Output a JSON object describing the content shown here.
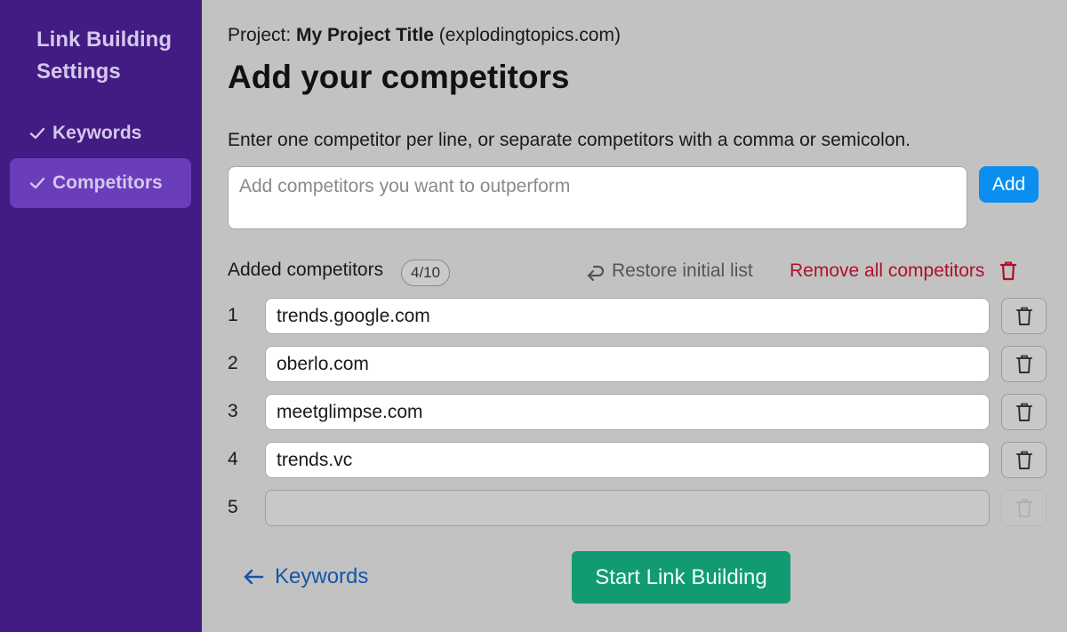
{
  "sidebar": {
    "title": "Link Building Settings",
    "items": [
      {
        "label": "Keywords",
        "completed": true,
        "active": false
      },
      {
        "label": "Competitors",
        "completed": true,
        "active": true
      }
    ]
  },
  "header": {
    "project_prefix": "Project:",
    "project_name": "My Project Title",
    "project_domain": "(explodingtopics.com)",
    "title": "Add your competitors"
  },
  "form": {
    "instructions": "Enter one competitor per line, or separate competitors with a comma or semicolon.",
    "input_placeholder": "Add competitors you want to outperform",
    "add_label": "Add"
  },
  "list": {
    "label": "Added competitors",
    "count": "4/10",
    "restore_label": "Restore initial list",
    "remove_all_label": "Remove all competitors",
    "rows": [
      {
        "num": "1",
        "value": "trends.google.com"
      },
      {
        "num": "2",
        "value": "oberlo.com"
      },
      {
        "num": "3",
        "value": "meetglimpse.com"
      },
      {
        "num": "4",
        "value": "trends.vc"
      },
      {
        "num": "5",
        "value": ""
      }
    ]
  },
  "footer": {
    "back_label": "Keywords",
    "start_label": "Start Link Building"
  },
  "colors": {
    "sidebar_bg": "#421c82",
    "active_item_bg": "#6a3dba",
    "add_button": "#0a8ff0",
    "start_button": "#129b73",
    "remove_red": "#b0102a",
    "link_blue": "#1456a8"
  }
}
